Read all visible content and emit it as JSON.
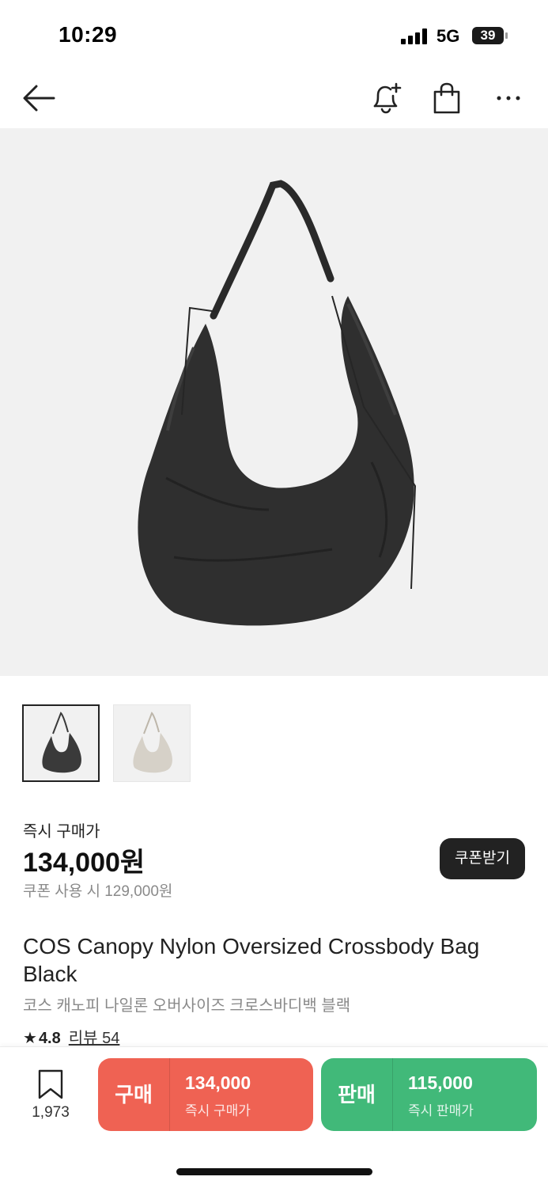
{
  "status_bar": {
    "time": "10:29",
    "network": "5G",
    "battery": "39"
  },
  "nav": {
    "back_icon": "arrow-left-icon",
    "alert_icon": "bell-plus-icon",
    "bag_icon": "shopping-bag-icon",
    "more_icon": "more-horizontal-icon"
  },
  "product": {
    "buy_now_label": "즉시 구매가",
    "price": "134,000원",
    "coupon_price": "쿠폰 사용 시 129,000원",
    "coupon_button": "쿠폰받기",
    "title": "COS Canopy Nylon Oversized Crossbody Bag Black",
    "subtitle": "코스 캐노피 나일론 오버사이즈 크로스바디백 블랙",
    "rating": "4.8",
    "review_label": "리뷰 54"
  },
  "thumbnails": [
    {
      "color": "#3a3a3a",
      "selected": true
    },
    {
      "color": "#d6d1c8",
      "selected": false
    }
  ],
  "bottom_bar": {
    "bookmark_count": "1,973",
    "buy": {
      "label": "구매",
      "amount": "134,000",
      "sub": "즉시 구매가",
      "color": "#ef6253"
    },
    "sell": {
      "label": "판매",
      "amount": "115,000",
      "sub": "즉시 판매가",
      "color": "#41b979"
    }
  }
}
